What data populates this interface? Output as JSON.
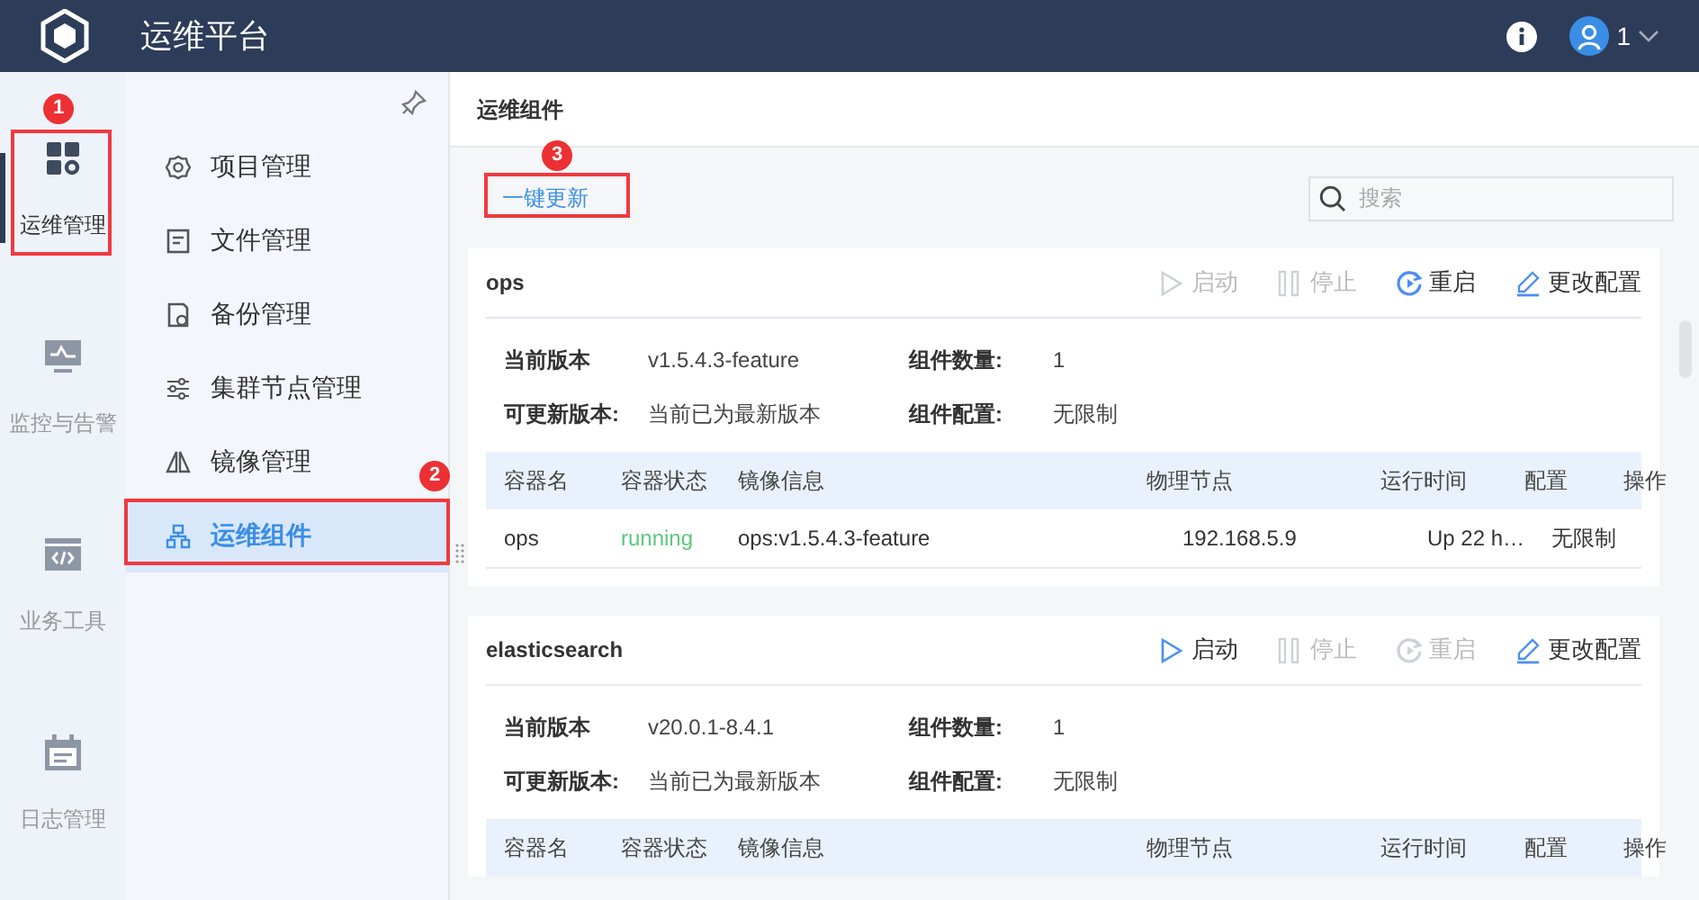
{
  "header": {
    "title": "运维平台",
    "user": "1"
  },
  "rail": [
    {
      "label": "运维管理",
      "selected": true,
      "callout": "1"
    },
    {
      "label": "监控与告警",
      "selected": false
    },
    {
      "label": "业务工具",
      "selected": false
    },
    {
      "label": "日志管理",
      "selected": false
    }
  ],
  "submenu": [
    {
      "label": "项目管理",
      "selected": false
    },
    {
      "label": "文件管理",
      "selected": false
    },
    {
      "label": "备份管理",
      "selected": false
    },
    {
      "label": "集群节点管理",
      "selected": false
    },
    {
      "label": "镜像管理",
      "selected": false
    },
    {
      "label": "运维组件",
      "selected": true,
      "callout": "2"
    }
  ],
  "page_title": "运维组件",
  "toolbar": {
    "button": "一键更新",
    "callout": "3",
    "search": {
      "placeholder": "搜索"
    }
  },
  "components": [
    {
      "name": "ops",
      "actions": [
        {
          "kind": "start",
          "label": "启动",
          "disabled": true
        },
        {
          "kind": "stop",
          "label": "停止",
          "disabled": true
        },
        {
          "kind": "restart",
          "label": "重启",
          "disabled": false
        },
        {
          "kind": "edit",
          "label": "更改配置",
          "disabled": false
        }
      ],
      "info": [
        {
          "label": "当前版本",
          "value": "v1.5.4.3-feature"
        },
        {
          "label": "组件数量:",
          "value": "1"
        },
        {
          "label": "可更新版本:",
          "value": "当前已为最新版本"
        },
        {
          "label": "组件配置:",
          "value": "无限制"
        }
      ],
      "columns": [
        "容器名",
        "容器状态",
        "镜像信息",
        "物理节点",
        "运行时间",
        "配置",
        "操作"
      ],
      "rows": [
        {
          "cells": [
            "ops",
            "running",
            "ops:v1.5.4.3-feature",
            "192.168.5.9",
            "Up 22 h…",
            "无限制"
          ],
          "color": "#5ec77d"
        }
      ]
    },
    {
      "name": "elasticsearch",
      "actions": [
        {
          "kind": "start",
          "label": "启动",
          "disabled": false
        },
        {
          "kind": "stop",
          "label": "停止",
          "disabled": true
        },
        {
          "kind": "restart",
          "label": "重启",
          "disabled": true
        },
        {
          "kind": "edit",
          "label": "更改配置",
          "disabled": false
        }
      ],
      "info": [
        {
          "label": "当前版本",
          "value": "v20.0.1-8.4.1"
        },
        {
          "label": "组件数量:",
          "value": "1"
        },
        {
          "label": "可更新版本:",
          "value": "当前已为最新版本"
        },
        {
          "label": "组件配置:",
          "value": "无限制"
        }
      ],
      "columns": [
        "容器名",
        "容器状态",
        "镜像信息",
        "物理节点",
        "运行时间",
        "配置",
        "操作"
      ]
    }
  ]
}
